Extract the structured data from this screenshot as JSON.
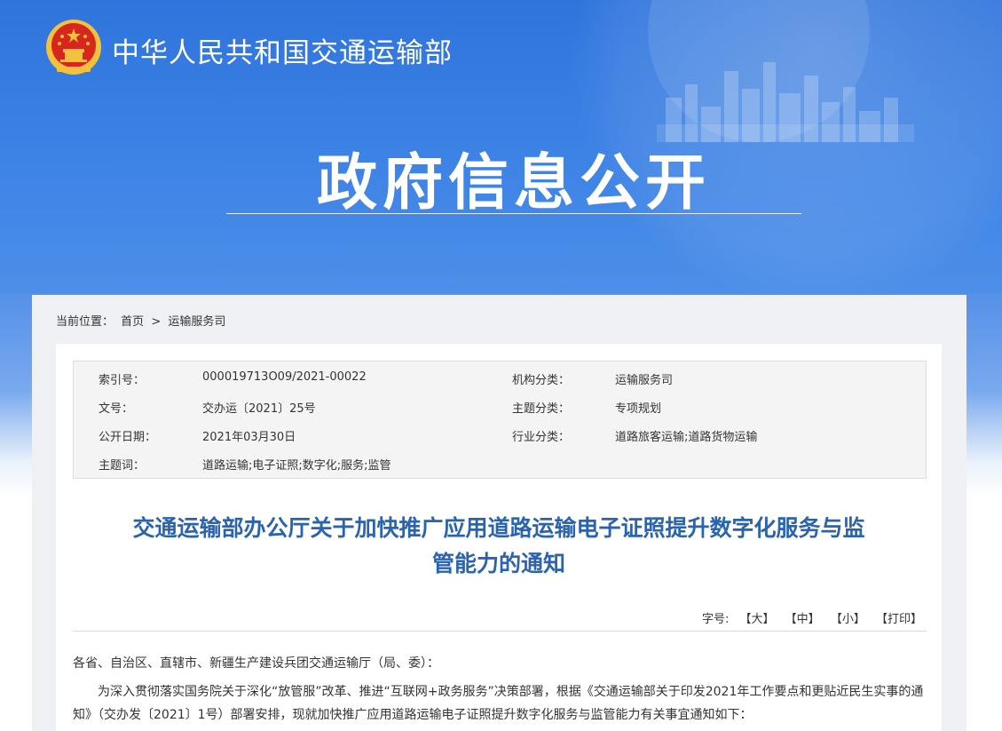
{
  "header": {
    "ministry_name": "中华人民共和国交通运输部",
    "banner_title": "政府信息公开",
    "colors": {
      "banner_blue": "#3a7fe0",
      "title_blue": "#2a63ae",
      "emblem_red": "#d7261e",
      "emblem_gold": "#f3c23c"
    }
  },
  "breadcrumb": {
    "prefix": "当前位置：",
    "home": "首页",
    "separator": ">",
    "current": "运输服务司"
  },
  "meta": {
    "rows": [
      {
        "k1": "索引号：",
        "v1": "000019713O09/2021-00022",
        "k2": "机构分类：",
        "v2": "运输服务司"
      },
      {
        "k1": "文号：",
        "v1": "交办运〔2021〕25号",
        "k2": "主题分类：",
        "v2": "专项规划"
      },
      {
        "k1": "公开日期：",
        "v1": "2021年03月30日",
        "k2": "行业分类：",
        "v2": "道路旅客运输;道路货物运输"
      },
      {
        "k1": "主题词：",
        "v1": "道路运输;电子证照;数字化;服务;监管",
        "k2": "",
        "v2": ""
      }
    ]
  },
  "document": {
    "title_line1": "交通运输部办公厅关于加快推广应用道路运输电子证照提升数字化服务与监",
    "title_line2": "管能力的通知",
    "font_size_label": "字号:",
    "font_large": "【大】",
    "font_medium": "【中】",
    "font_small": "【小】",
    "print": "【打印】",
    "salutation": "各省、自治区、直辖市、新疆生产建设兵团交通运输厅（局、委）：",
    "paragraph1": "为深入贯彻落实国务院关于深化“放管服”改革、推进“互联网+政务服务”决策部署，根据《交通运输部关于印发2021年工作要点和更贴近民生实事的通知》（交办发〔2021〕1号）部署安排，现就加快推广应用道路运输电子证照提升数字化服务与监管能力有关事宜通知如下："
  }
}
